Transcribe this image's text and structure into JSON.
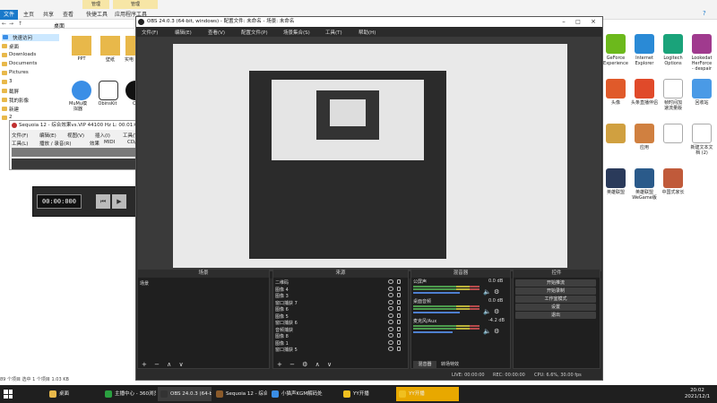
{
  "explorer": {
    "ribbon_tabs": [
      "文件",
      "主页",
      "共享",
      "查看",
      "快捷工具",
      "应用程序工具"
    ],
    "context_tabs": [
      "管理",
      "管理"
    ],
    "address": "桌面",
    "nav": [
      {
        "label": "快速访问",
        "sel": true
      },
      {
        "label": "桌面"
      },
      {
        "label": "Downloads"
      },
      {
        "label": "Documents"
      },
      {
        "label": "Pictures"
      },
      {
        "label": "3"
      },
      {
        "label": "截屏"
      },
      {
        "label": "我的影像"
      },
      {
        "label": "新建"
      },
      {
        "label": "2"
      }
    ],
    "icons": [
      {
        "label": "PPT",
        "color": "#e8b84a"
      },
      {
        "label": "壁纸",
        "color": "#e8b84a"
      },
      {
        "label": "实电",
        "color": "#e8b84a"
      }
    ],
    "icons_row2": [
      {
        "label": "MuMu模\n拟器",
        "color": "#3a8ee6"
      },
      {
        "label": "ObinsKit",
        "color": "#ffffff"
      },
      {
        "label": "O",
        "color": "#111111"
      }
    ],
    "status": "89 个项目    选中 1 个项目 1.03 KB"
  },
  "desktop": {
    "icons": [
      {
        "label": "GeForce\nExperience",
        "color": "#6cb91c"
      },
      {
        "label": "Internet\nExplorer",
        "color": "#2a8ad6"
      },
      {
        "label": "Logitech\nOptions",
        "color": "#1aa37a"
      },
      {
        "label": "Lookedat\nHerForce\n- despair",
        "color": "#a03a8e"
      },
      {
        "label": "头像\n",
        "color": "#e05a2a"
      },
      {
        "label": "头条直播伴侣",
        "color": "#e04a2a"
      },
      {
        "label": "帧时间加\n速流量版",
        "color": "#ffffff"
      },
      {
        "label": "回收站",
        "color": "#4a9ae6"
      },
      {
        "label": "",
        "color": "#d0a040"
      },
      {
        "label": "应用",
        "color": "#d08040"
      },
      {
        "label": "",
        "color": "#ffffff"
      },
      {
        "label": "新建文本文\n档 (2)",
        "color": "#ffffff"
      },
      {
        "label": "英雄联盟",
        "color": "#2a3a5a"
      },
      {
        "label": "英雄联盟\nWeGame版",
        "color": "#2a5a8a"
      },
      {
        "label": "中国式家长",
        "color": "#c05a3a"
      }
    ]
  },
  "sequoia": {
    "title": "Sequoia 12 - 综合效果vs.VIP    44100 Hz L: 00:01:0...",
    "menu1": [
      "文件(F)",
      "编辑(E)",
      "视图(V)",
      "插入(I)",
      "工具(T)",
      "添加对象(O)",
      "选项(O)"
    ],
    "menu2": [
      "工具(L)",
      "播放 / 录音(R)",
      "效果",
      "MIDI",
      "CD/DVD",
      "选项(O)",
      "窗"
    ]
  },
  "timer": {
    "time": "00:00:000"
  },
  "obs": {
    "title": "OBS 24.0.3 (64-bit, windows) - 配置文件: 未命名 - 场景: 未命名",
    "menu": [
      "文件(F)",
      "编辑(E)",
      "查看(V)",
      "配置文件(P)",
      "场景集合(S)",
      "工具(T)",
      "帮助(H)"
    ],
    "docks": {
      "scenes": {
        "header": "场景",
        "items": [
          "场景"
        ]
      },
      "sources": {
        "header": "来源",
        "items": [
          "二维码",
          "图像 4",
          "图像 3",
          "窗口捕获 7",
          "图像 6",
          "图像 5",
          "窗口捕获 6",
          "音频捕获",
          "图像 8",
          "图像 1",
          "窗口捕获 5"
        ]
      },
      "mixer": {
        "header": "混音器",
        "channels": [
          {
            "name": "公屏声",
            "db": "0.0 dB",
            "level": 0.7
          },
          {
            "name": "桌面音频",
            "db": "0.0 dB",
            "level": 0.7
          },
          {
            "name": "麦克风/Aux",
            "db": "-4.2 dB",
            "level": 0.6
          }
        ],
        "tabs": [
          "混音器",
          "转场特效"
        ]
      },
      "controls": {
        "header": "控件",
        "buttons": [
          "开始推流",
          "开始录制",
          "工作室模式",
          "设置",
          "退出"
        ]
      }
    },
    "status": {
      "live": "LIVE: 00:00:00",
      "rec": "REC: 00:00:00",
      "cpu": "CPU: 6.6%, 30.00 fps"
    }
  },
  "taskbar": {
    "items": [
      {
        "label": "桌面",
        "color": "#e8b84a",
        "active": false
      },
      {
        "label": "主播中心 - 360浏览...",
        "color": "#2aa040",
        "active": false
      },
      {
        "label": "OBS 24.0.3 (64-bit,...",
        "color": "#333",
        "active": true
      },
      {
        "label": "Sequoia 12 - 综合效...",
        "color": "#8a5a2a",
        "active": false
      },
      {
        "label": "小猫声KGM解码处...",
        "color": "#3a8ee6",
        "active": false
      },
      {
        "label": "YY开播",
        "color": "#f0c020",
        "active": false
      },
      {
        "label": "YY开播",
        "color": "#f0c020",
        "active": true
      }
    ],
    "clock_time": "20:02",
    "clock_date": "2021/12/1"
  }
}
